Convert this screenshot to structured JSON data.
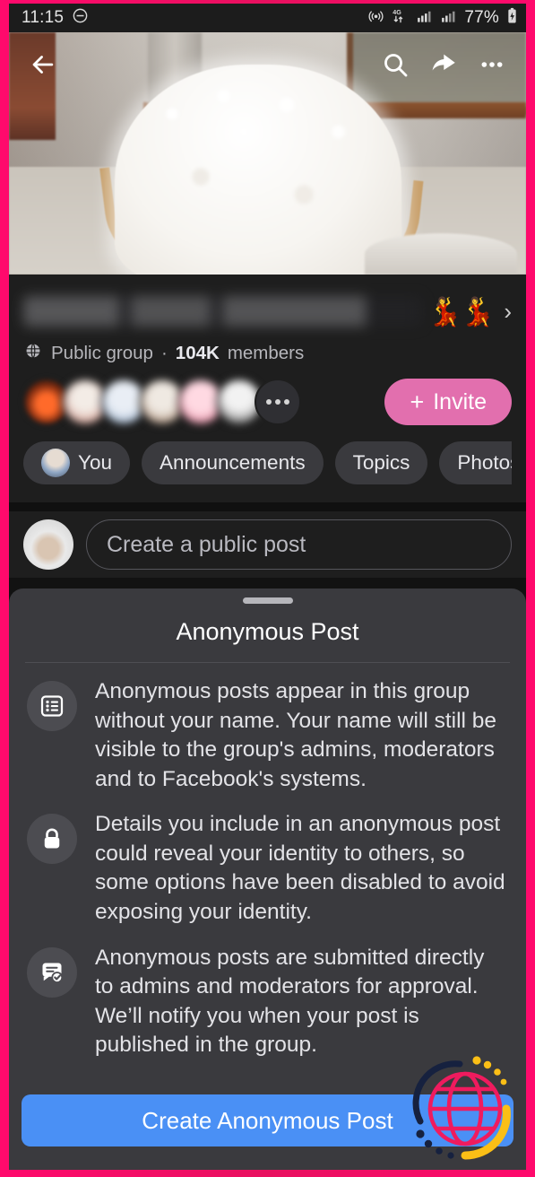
{
  "statusbar": {
    "time": "11:15",
    "dnd_icon": "do-not-disturb-icon",
    "hotspot_icon": "hotspot-icon",
    "network_label": "4G",
    "signal_icon": "signal-bars-icon",
    "battery_text": "77%",
    "battery_icon": "battery-charging-icon"
  },
  "topnav": {
    "back_icon": "back-arrow-icon",
    "search_icon": "search-icon",
    "share_icon": "share-arrow-icon",
    "more_icon": "more-options-icon"
  },
  "group": {
    "name_redacted": "",
    "name_emojis": "💃💃",
    "chevron_icon": "chevron-right-icon",
    "privacy_icon": "globe-icon",
    "privacy_label": "Public group",
    "separator": "·",
    "member_count": "104K",
    "member_label": "members",
    "facepile_overflow": "more-members-icon",
    "invite_plus": "+",
    "invite_label": "Invite",
    "invite_color": "#e26fae",
    "chips": [
      {
        "label": "You",
        "has_avatar": true
      },
      {
        "label": "Announcements",
        "has_avatar": false
      },
      {
        "label": "Topics",
        "has_avatar": false
      },
      {
        "label": "Photos",
        "has_avatar": false
      }
    ]
  },
  "composer": {
    "placeholder": "Create a public post"
  },
  "sheet": {
    "title": "Anonymous Post",
    "handle": "drag-handle",
    "items": [
      {
        "icon": "rules-list-icon",
        "text": "Anonymous posts appear in this group without your name. Your name will still be visible to the group's admins, moderators and to Facebook's systems."
      },
      {
        "icon": "lock-icon",
        "text": "Details you include in an anonymous post could reveal your identity to others, so some options have been disabled to avoid exposing your identity."
      },
      {
        "icon": "message-check-icon",
        "text": "Anonymous posts are submitted directly to admins and moderators for approval. We’ll notify you when your post is published in the group."
      }
    ],
    "cta_label": "Create Anonymous Post",
    "cta_color": "#4a90f5"
  },
  "watermark": {
    "icon": "globe-watermark-icon",
    "globe_color": "#ef1b5e",
    "arc_dark_color": "#16213f",
    "arc_yellow_color": "#fbbf16"
  },
  "frame": {
    "border_color": "#ec1266"
  }
}
